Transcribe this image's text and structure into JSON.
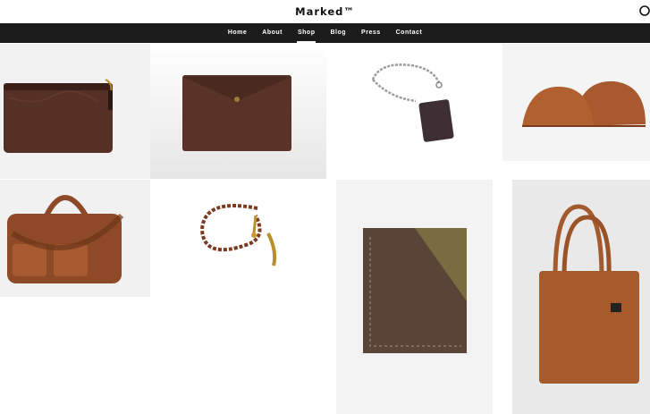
{
  "site": {
    "brand": "Marked™"
  },
  "nav": {
    "items": [
      "Home",
      "About",
      "Shop",
      "Blog",
      "Press",
      "Contact"
    ],
    "active": "Shop"
  },
  "products": [
    {
      "name": "leather-zip-pouch",
      "icon": "zip-pouch"
    },
    {
      "name": "envelope-clutch",
      "icon": "envelope-clutch"
    },
    {
      "name": "chain-wallet-keychain",
      "icon": "chain-card-holder"
    },
    {
      "name": "curved-pouches",
      "icon": "curved-pouch-pair"
    },
    {
      "name": "duffel-bag",
      "icon": "duffel-bag"
    },
    {
      "name": "braided-wallet-chain",
      "icon": "braided-chain"
    },
    {
      "name": "card-sleeve",
      "icon": "card-sleeve"
    },
    {
      "name": "tote-bag",
      "icon": "tote-bag"
    }
  ],
  "colors": {
    "nav_bg": "#1c1c1c",
    "leather_dark": "#4e2d22",
    "leather_tan": "#9a5530",
    "photo_bg": "#eeeeee"
  }
}
